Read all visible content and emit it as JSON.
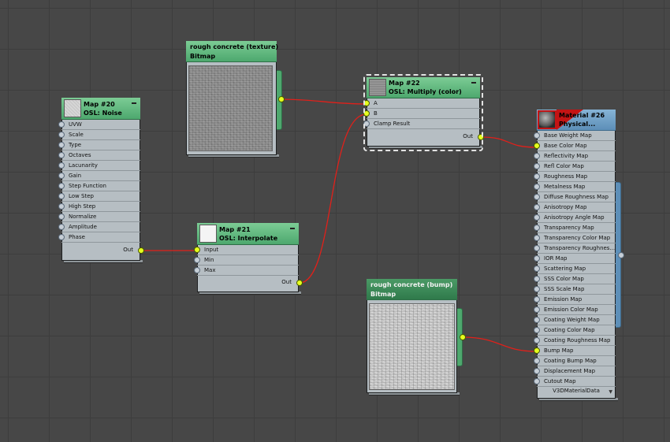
{
  "colors": {
    "background": "#474747",
    "wire": "#e1201a",
    "socket_connected": "#e6ff1f",
    "socket_empty": "#c6ced6",
    "map_header": "#5eb77e",
    "material_header": "#6f9fc6",
    "node_body": "#b6bec3"
  },
  "nodes": {
    "noise": {
      "title_line1": "Map #20",
      "title_line2": "OSL: Noise",
      "inputs": [
        "UVW",
        "Scale",
        "Type",
        "Octaves",
        "Lacunarity",
        "Gain",
        "Step Function",
        "Low Step",
        "High Step",
        "Normalize",
        "Amplitude",
        "Phase"
      ],
      "output": "Out"
    },
    "interpolate": {
      "title_line1": "Map #21",
      "title_line2": "OSL: Interpolate",
      "inputs": [
        "Input",
        "Min",
        "Max"
      ],
      "output": "Out"
    },
    "multiply": {
      "title_line1": "Map #22",
      "title_line2": "OSL: Multiply (color)",
      "inputs": [
        "A",
        "B",
        "Clamp Result"
      ],
      "output": "Out"
    },
    "tex_bitmap": {
      "title_line1": "rough concrete (texture)",
      "title_line2": "Bitmap"
    },
    "bump_bitmap": {
      "title_line1": "rough concrete (bump)",
      "title_line2": "Bitmap"
    },
    "material": {
      "title_line1": "Material #26",
      "title_line2": "Physical...",
      "inputs": [
        "Base Weight Map",
        "Base Color Map",
        "Reflectivity Map",
        "Refl Color Map",
        "Roughness Map",
        "Metalness Map",
        "Diffuse Roughness Map",
        "Anisotropy Map",
        "Anisotropy Angle Map",
        "Transparency Map",
        "Transparency Color Map",
        "Transparency  Roughnes...",
        "IOR Map",
        "Scattering Map",
        "SSS Color Map",
        "SSS Scale Map",
        "Emission Map",
        "Emission Color Map",
        "Coating Weight Map",
        "Coating Color Map",
        "Coating Roughness Map",
        "Bump Map",
        "Coating Bump Map",
        "Displacement Map",
        "Cutout Map"
      ],
      "footer": "V3DMaterialData"
    }
  }
}
